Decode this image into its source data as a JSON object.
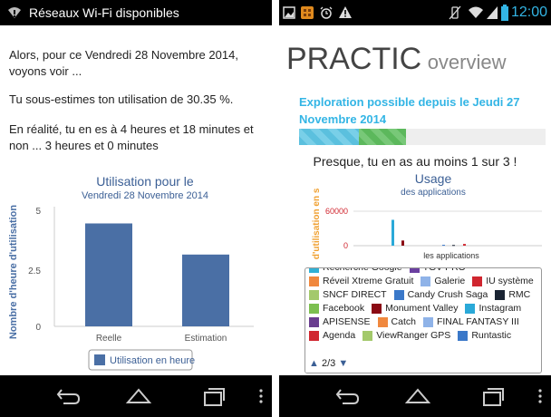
{
  "left": {
    "notification": {
      "text": "Réseaux Wi-Fi disponibles",
      "icon": "wifi-alert-icon"
    },
    "paragraphs": [
      "Alors, pour ce Vendredi 28 Novembre 2014, voyons voir ...",
      "Tu sous-estimes ton utilisation de 30.35 %.",
      "En réalité, tu en es à 4 heures et 18 minutes et non ... 3 heures et 0 minutes"
    ],
    "chart": {
      "title": "Utilisation pour le",
      "subtitle": "Vendredi 28 Novembre 2014",
      "ylabel": "Nombre d'heure d'utilisation",
      "yticks": [
        "5",
        "2.5",
        "0"
      ],
      "legend": "Utilisation en heure",
      "bar_color": "#4a6fa5"
    },
    "chart_data": {
      "type": "bar",
      "title": "Utilisation pour le",
      "subtitle": "Vendredi 28 Novembre 2014",
      "xlabel": "",
      "ylabel": "Nombre d'heure d'utilisation",
      "categories": [
        "Reelle",
        "Estimation"
      ],
      "series": [
        {
          "name": "Utilisation en heure",
          "values": [
            4.3,
            3.0
          ]
        }
      ],
      "ylim": [
        0,
        5
      ],
      "grid": false,
      "legend_position": "bottom"
    }
  },
  "right": {
    "status": {
      "time": "12:00"
    },
    "title_main": "PRACTIC",
    "title_sub": "overview",
    "exploration_text": "Exploration possible depuis le Jeudi 27 Novembre 2014",
    "progress": {
      "segments": [
        "#5bc0de",
        "#5cb85c"
      ],
      "fraction": 0.43
    },
    "headline": "Presque, tu en as au moins 1 sur 3 !",
    "chart": {
      "title": "Usage",
      "subtitle": "des applications",
      "xlabel": "les applications",
      "ylabel": "Temps d'utilisation en s",
      "yticks": [
        "60000",
        "0"
      ]
    },
    "chart_data": {
      "type": "bar",
      "title": "Usage",
      "subtitle": "des applications",
      "xlabel": "les applications",
      "ylabel": "Temps d'utilisation en s",
      "ylim": [
        -10000,
        70000
      ],
      "series": [
        {
          "name": "Instagram",
          "values": [
            45000
          ]
        },
        {
          "name": "Monument Valley",
          "values": [
            9000
          ]
        },
        {
          "name": "Runtastic",
          "values": [
            1500
          ]
        },
        {
          "name": "RMC",
          "values": [
            1200
          ]
        },
        {
          "name": "IU système",
          "values": [
            3000
          ]
        }
      ]
    },
    "legend": {
      "items": [
        {
          "label": "Recherche Google",
          "color": "#31b0d5"
        },
        {
          "label": "TGV PRO",
          "color": "#6b3fa0"
        },
        {
          "label": "Réveil Xtreme Gratuit",
          "color": "#f0883e"
        },
        {
          "label": "Galerie",
          "color": "#8fb3e8"
        },
        {
          "label": "IU système",
          "color": "#d0262f"
        },
        {
          "label": "SNCF DIRECT",
          "color": "#a3c96b"
        },
        {
          "label": "Candy Crush Saga",
          "color": "#3a78c9"
        },
        {
          "label": "RMC",
          "color": "#1a2433"
        },
        {
          "label": "Facebook",
          "color": "#7cbf4f"
        },
        {
          "label": "Monument Valley",
          "color": "#8b0a14"
        },
        {
          "label": "Instagram",
          "color": "#2aa9d8"
        },
        {
          "label": "APISENSE",
          "color": "#6a3d8f"
        },
        {
          "label": "Catch",
          "color": "#f0883e"
        },
        {
          "label": "FINAL FANTASY III",
          "color": "#8fb3e8"
        },
        {
          "label": "Agenda",
          "color": "#d0262f"
        },
        {
          "label": "ViewRanger GPS",
          "color": "#a3c96b"
        },
        {
          "label": "Runtastic",
          "color": "#3a78c9"
        }
      ],
      "pager": "2/3"
    }
  }
}
